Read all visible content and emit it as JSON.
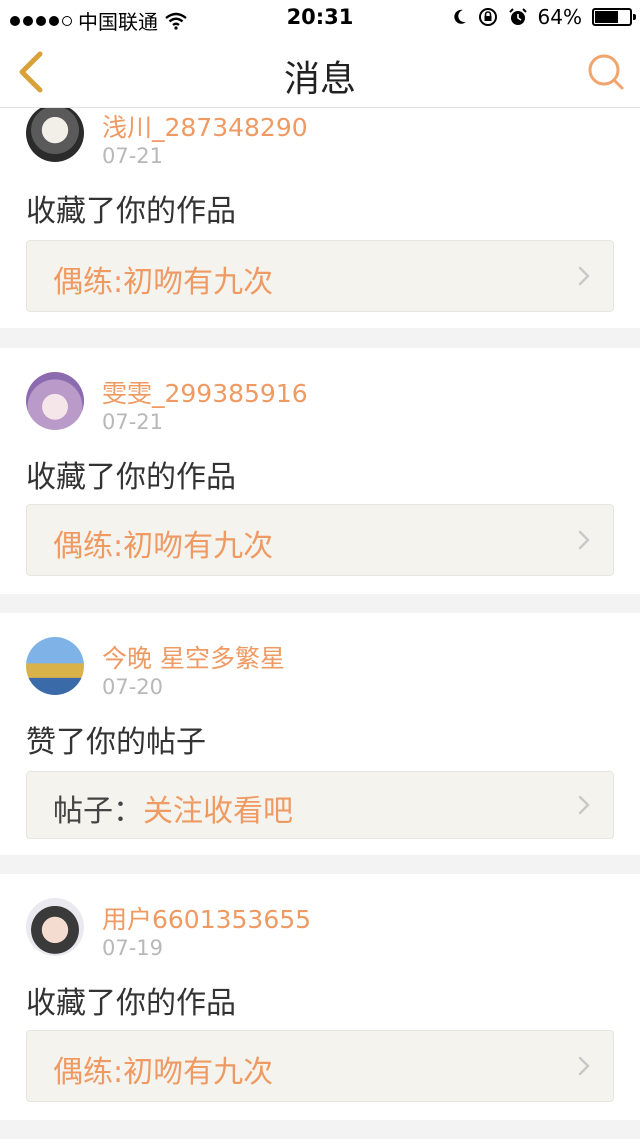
{
  "status_bar": {
    "carrier": "中国联通",
    "time": "20:31",
    "battery_percent": "64%",
    "battery_level": 0.64
  },
  "nav": {
    "title": "消息"
  },
  "messages": [
    {
      "username": "浅川_287348290",
      "date": "07-21",
      "action": "收藏了你的作品",
      "ref_prefix": "",
      "ref_text": "偶练:初吻有九次"
    },
    {
      "username": "雯雯_299385916",
      "date": "07-21",
      "action": "收藏了你的作品",
      "ref_prefix": "",
      "ref_text": "偶练:初吻有九次"
    },
    {
      "username": "今晚 星空多繁星",
      "date": "07-20",
      "action": "赞了你的帖子",
      "ref_prefix": "帖子：",
      "ref_text": "关注收看吧"
    },
    {
      "username": "用户6601353655",
      "date": "07-19",
      "action": "收藏了你的作品",
      "ref_prefix": "",
      "ref_text": "偶练:初吻有九次"
    }
  ],
  "colors": {
    "accent": "#f09a63",
    "date_gray": "#b8b8b8",
    "ref_bg": "#f4f3ee",
    "back_chevron": "#d9a13a"
  },
  "icons": {
    "back": "chevron-left-icon",
    "search": "search-icon",
    "ref_arrow": "chevron-right-icon"
  }
}
